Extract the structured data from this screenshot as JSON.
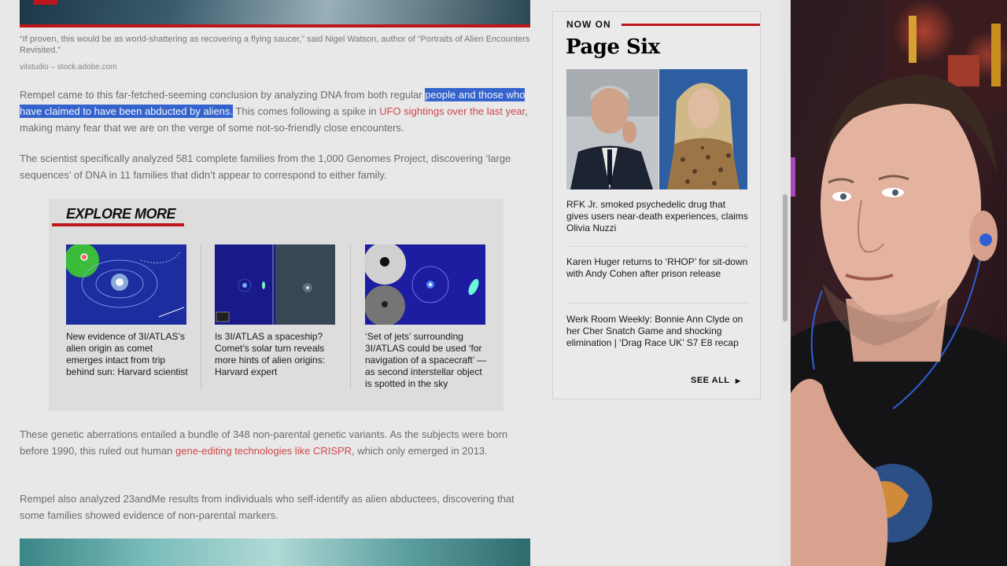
{
  "article": {
    "caption": "“If proven, this would be as world-shattering as recovering a flying saucer,” said Nigel Watson, author of “Portraits of Alien Encounters Revisited.”",
    "credit": "vitstudio – stock.adobe.com",
    "p1_a": "Rempel came to this far-fetched-seeming conclusion by analyzing DNA from both regular ",
    "p1_hl": "people and those who have claimed to have been abducted by aliens.",
    "p1_b": " This comes following a spike in ",
    "p1_link": "UFO sightings over the last year",
    "p1_c": ", making many fear that we are on the verge of some not-so-friendly close encounters.",
    "p2": "The scientist specifically analyzed 581 complete families from the 1,000 Genomes Project, discovering ‘large sequences’ of DNA in 11 families that didn’t appear to correspond to either family.",
    "p3_a": "These genetic aberrations entailed a bundle of 348 non-parental genetic variants. As the subjects were born before 1990, this ruled out human ",
    "p3_link": "gene-editing technologies like CRISPR",
    "p3_b": ", which only emerged in 2013.",
    "p4": "Rempel also analyzed 23andMe results from individuals who self-identify as alien abductees, discovering that some families showed evidence of non-parental markers."
  },
  "explore": {
    "title": "EXPLORE MORE",
    "items": [
      {
        "text": "New evidence of 3I/ATLAS’s alien origin as comet emerges intact from trip behind sun: Harvard scientist"
      },
      {
        "text": "Is 3I/ATLAS a spaceship? Comet’s solar turn reveals more hints of alien origins: Harvard expert"
      },
      {
        "text": "‘Set of jets’ surrounding 3I/ATLAS could be used ‘for navigation of a spacecraft’ — as second interstellar object is spotted in the sky"
      }
    ]
  },
  "sidebar": {
    "label": "NOW ON",
    "brand": "Page Six",
    "items": [
      {
        "text": "RFK Jr. smoked psychedelic drug that gives users near-death experiences, claims Olivia Nuzzi"
      },
      {
        "text": "Karen Huger returns to ‘RHOP’ for sit-down with Andy Cohen after prison release"
      },
      {
        "text": "Werk Room Weekly: Bonnie Ann Clyde on her Cher Snatch Game and shocking elimination | ‘Drag Race UK’ S7 E8 recap"
      }
    ],
    "see_all": "SEE ALL",
    "see_all_icon": "caret-right-icon"
  },
  "colors": {
    "accent": "#c4161c",
    "selection": "#3667d6",
    "link": "#d64a4f"
  }
}
